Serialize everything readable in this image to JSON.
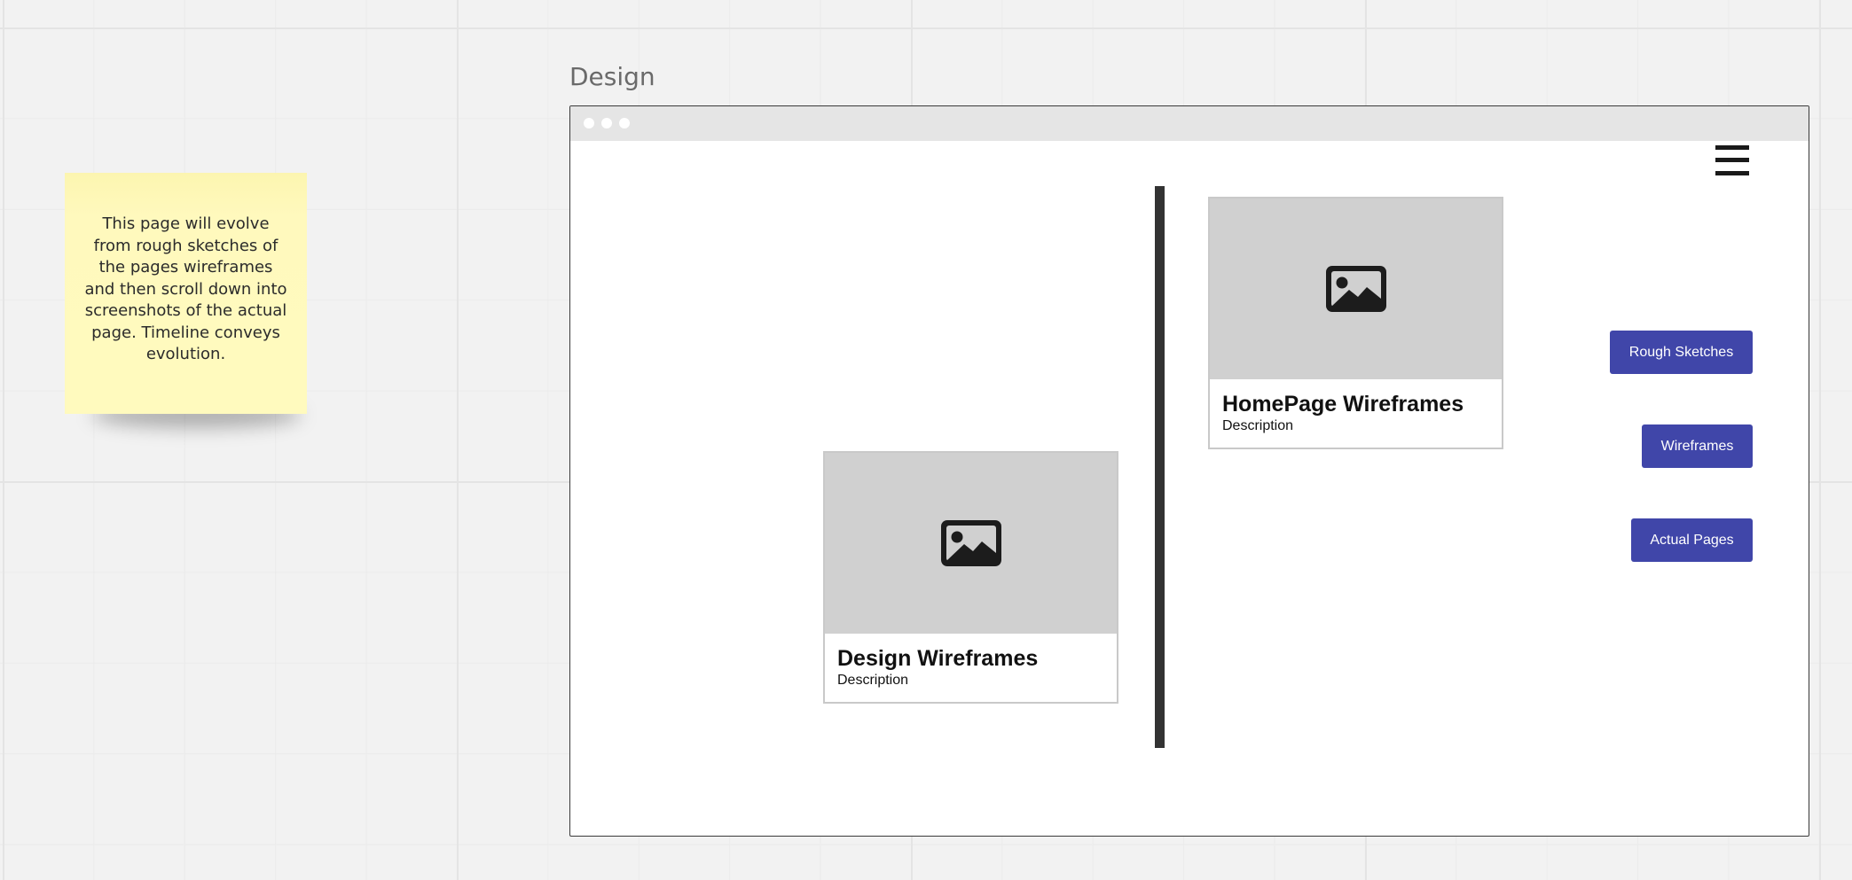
{
  "sticky_note": {
    "text": "This page will evolve from rough sketches of the pages wireframes and then scroll down into screenshots of the actual page. Timeline conveys evolution."
  },
  "frame": {
    "title": "Design"
  },
  "cards": [
    {
      "title": "HomePage Wireframes",
      "description": "Description",
      "icon": "image-placeholder-icon"
    },
    {
      "title": "Design Wireframes",
      "description": "Description",
      "icon": "image-placeholder-icon"
    }
  ],
  "nav": {
    "menu_icon": "hamburger-menu-icon",
    "buttons": [
      {
        "label": "Rough Sketches"
      },
      {
        "label": "Wireframes"
      },
      {
        "label": "Actual Pages"
      }
    ]
  },
  "colors": {
    "canvas_background": "#f2f2f2",
    "sticky_note": "#fffabe",
    "button": "#4046a9",
    "button_text": "#ffffff",
    "image_placeholder": "#d0d0d0",
    "timeline": "#333333",
    "browser_bar": "#e5e5e5"
  }
}
